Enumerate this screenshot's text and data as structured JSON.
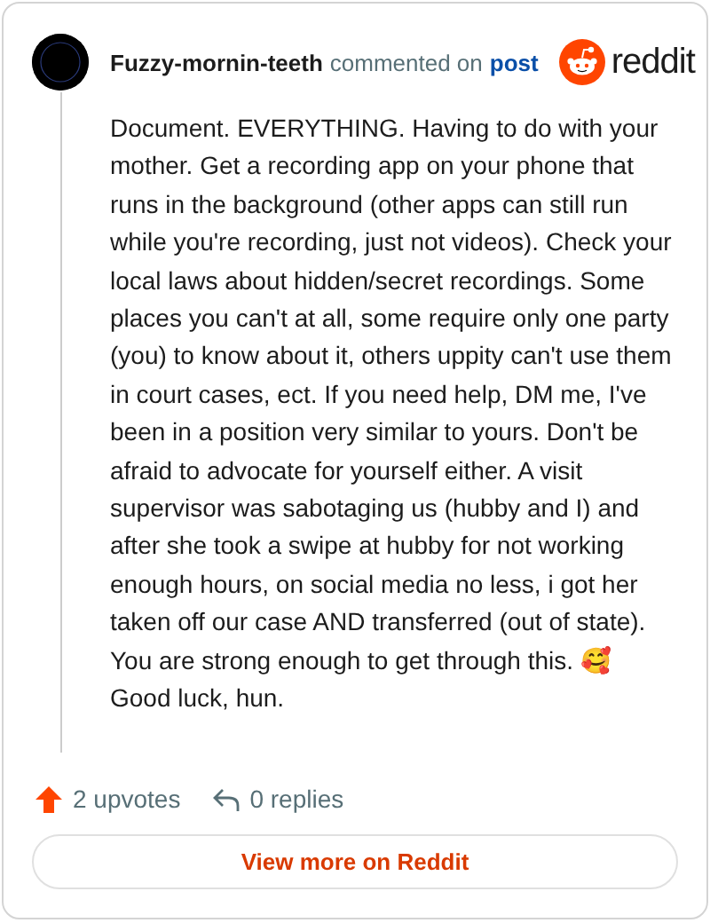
{
  "comment": {
    "author": "Fuzzy-mornin-teeth",
    "action": "commented on",
    "target": "post",
    "brand": "reddit",
    "body": "Document. EVERYTHING. Having to do with your mother. Get a recording app on your phone that runs in the background (other apps can still run while you're recording, just not videos). Check your local laws about hidden/secret recordings. Some places you can't at all, some require only one party (you) to know about it, others uppity can't use them in court cases, ect. If you need help, DM me, I've been in a position very similar to yours. Don't be afraid to advocate for yourself either. A visit supervisor was sabotaging us (hubby and I) and after she took a swipe at hubby for not working enough hours, on social media no less, i got her taken off our case AND transferred (out of state). You are strong enough to get through this. 🥰 Good luck, hun.",
    "upvotes": "2 upvotes",
    "replies": "0 replies",
    "button": "View more on Reddit"
  }
}
